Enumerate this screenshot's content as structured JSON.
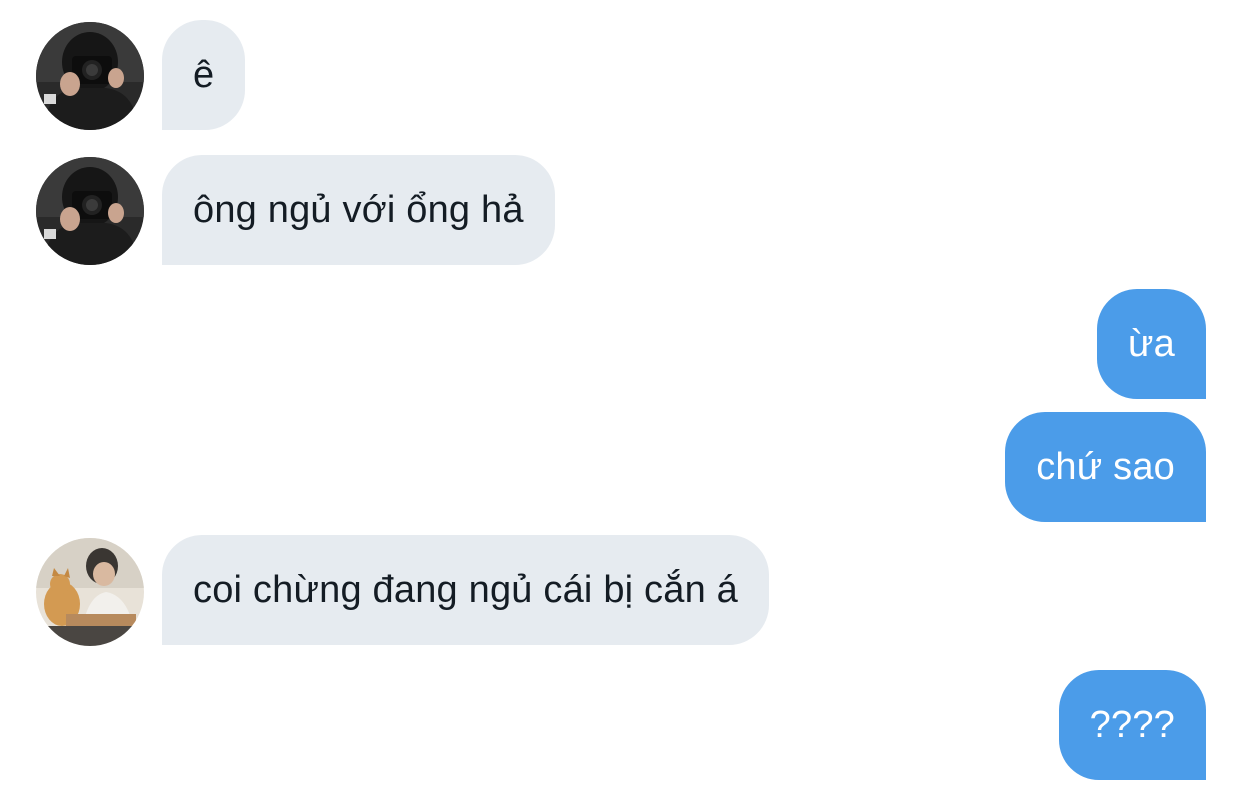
{
  "conversation": {
    "messages": [
      {
        "direction": "incoming",
        "sender_avatar": "avatar-camera-man",
        "text": "ê"
      },
      {
        "direction": "incoming",
        "sender_avatar": "avatar-camera-man",
        "text": "ông ngủ với ổng hả"
      },
      {
        "direction": "outgoing",
        "text": "ừa"
      },
      {
        "direction": "outgoing",
        "text": "chứ sao"
      },
      {
        "direction": "incoming",
        "sender_avatar": "avatar-man-with-cat",
        "text": "coi chừng đang ngủ cái bị cắn á"
      },
      {
        "direction": "outgoing",
        "text": "????"
      }
    ]
  },
  "colors": {
    "incoming_bubble": "#e6ebf0",
    "incoming_text": "#141c24",
    "outgoing_bubble": "#4b9ce9",
    "outgoing_text": "#ffffff",
    "background": "#ffffff"
  }
}
